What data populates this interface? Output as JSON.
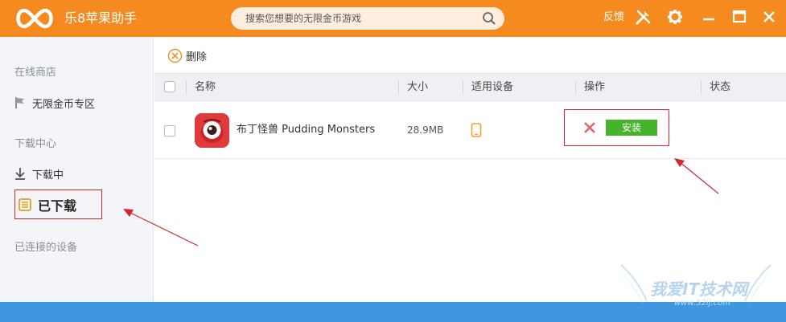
{
  "app": {
    "title": "乐8苹果助手",
    "search_placeholder": "搜索您想要的无限金币游戏",
    "feedback_label": "反馈"
  },
  "sidebar": {
    "section_store": "在线商店",
    "item_unlimited": "无限金币专区",
    "section_download": "下载中心",
    "item_downloading": "下载中",
    "item_downloaded": "已下载",
    "section_devices": "已连接的设备"
  },
  "toolbar": {
    "delete_label": "删除"
  },
  "table": {
    "columns": [
      "名称",
      "大小",
      "适用设备",
      "操作",
      "状态"
    ],
    "rows": [
      {
        "name": "布丁怪兽 Pudding Monsters",
        "size": "28.9MB",
        "install_label": "安装"
      }
    ]
  },
  "watermark": {
    "text": "我爱IT技术网",
    "sub": "www.52ij.com"
  },
  "colors": {
    "brand": "#f58a1f",
    "highlight": "#d6262b",
    "install": "#46b42a",
    "bottom": "#3f97e0"
  }
}
